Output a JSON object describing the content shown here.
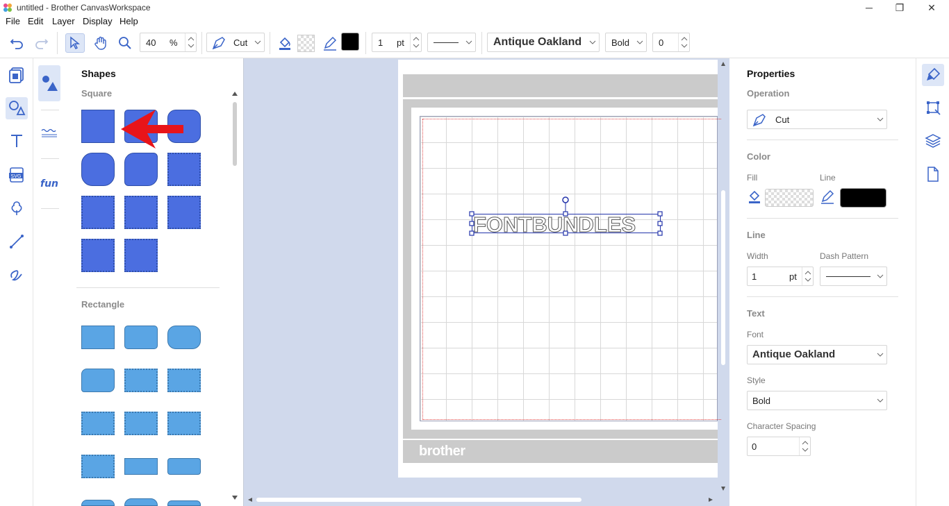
{
  "window": {
    "title": "untitled - Brother CanvasWorkspace",
    "controls": {
      "minimize": "─",
      "restore": "❐",
      "close": "✕"
    }
  },
  "menu": [
    "File",
    "Edit",
    "Layer",
    "Display",
    "Help"
  ],
  "toolbar": {
    "zoom_value": "40",
    "zoom_unit": "%",
    "operation": "Cut",
    "line_color": "#000000",
    "line_width": "1",
    "line_width_unit": "pt",
    "font": "Antique Oakland",
    "style": "Bold",
    "char_spacing": "0"
  },
  "left_rail": [
    "page-icon",
    "shapes-icon",
    "text-icon",
    "svg-icon",
    "cloud-icon",
    "line-icon",
    "freehand-icon"
  ],
  "shapes_panel": {
    "title": "Shapes",
    "square_label": "Square",
    "rectangle_label": "Rectangle"
  },
  "canvas": {
    "selected_text": "FONTBUNDLES",
    "brand": "brother"
  },
  "properties": {
    "title": "Properties",
    "operation_label": "Operation",
    "operation_value": "Cut",
    "color_label": "Color",
    "fill_label": "Fill",
    "line_label": "Line",
    "line_color": "#000000",
    "line_section": "Line",
    "width_label": "Width",
    "width_value": "1",
    "width_unit": "pt",
    "dash_label": "Dash Pattern",
    "text_section": "Text",
    "font_label": "Font",
    "font_value": "Antique Oakland",
    "style_label": "Style",
    "style_value": "Bold",
    "spacing_label": "Character Spacing",
    "spacing_value": "0"
  },
  "colors": {
    "accent": "#4b6ee0",
    "square_fill": "#4b6ee0",
    "rect_fill": "#5aa5e4",
    "canvas_bg": "#d0d9ec",
    "arrow": "#e8141a"
  }
}
